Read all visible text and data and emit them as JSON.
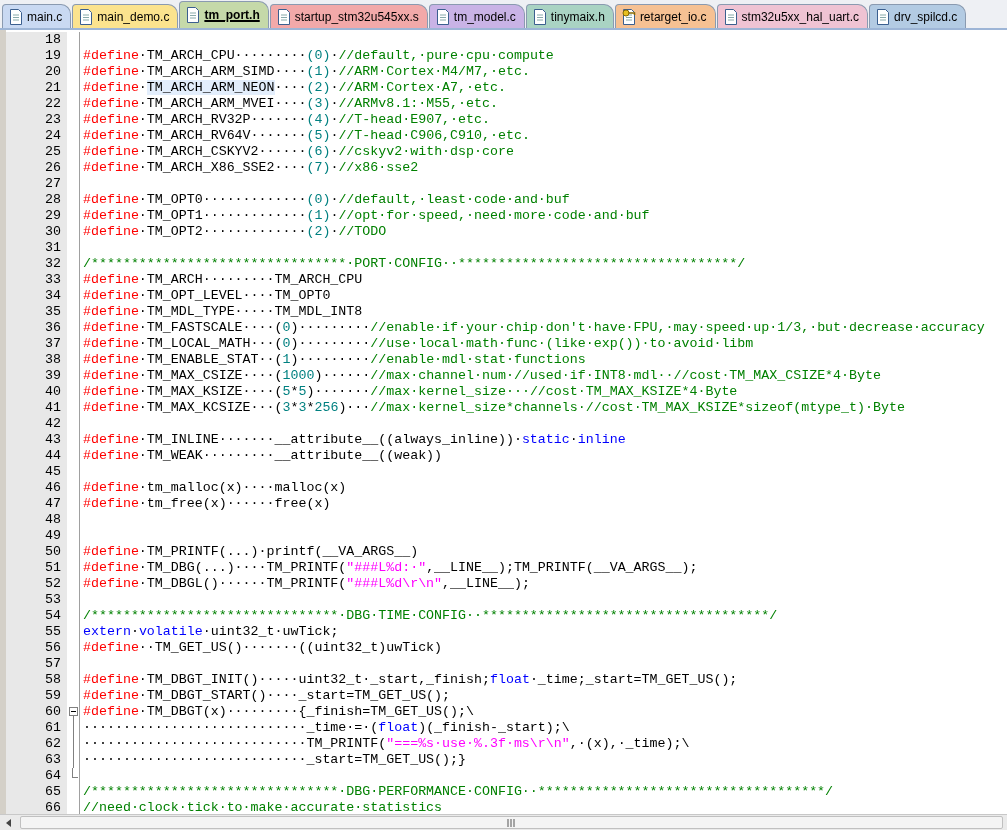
{
  "tabs": [
    {
      "label": "main.c",
      "selected": false,
      "color": "#c9d9f2",
      "kind": "file"
    },
    {
      "label": "main_demo.c",
      "selected": false,
      "color": "#fbe38e",
      "kind": "file"
    },
    {
      "label": "tm_port.h",
      "selected": true,
      "color": "#c5d9a9",
      "kind": "file"
    },
    {
      "label": "startup_stm32u545xx.s",
      "selected": false,
      "color": "#f2a9a9",
      "kind": "file"
    },
    {
      "label": "tm_model.c",
      "selected": false,
      "color": "#c9b3e6",
      "kind": "file"
    },
    {
      "label": "tinymaix.h",
      "selected": false,
      "color": "#a9d3c3",
      "kind": "file"
    },
    {
      "label": "retarget_io.c",
      "selected": false,
      "color": "#f6c193",
      "kind": "keyed"
    },
    {
      "label": "stm32u5xx_hal_uart.c",
      "selected": false,
      "color": "#efc3d3",
      "kind": "file"
    },
    {
      "label": "drv_spilcd.c",
      "selected": false,
      "color": "#b3cbe3",
      "kind": "file"
    }
  ],
  "editor": {
    "lines": [
      {
        "number": "18"
      },
      {
        "number": "19",
        "tokens": [
          {
            "kind": "directive",
            "text": "#define"
          },
          {
            "kind": "plain",
            "text": "·TM_ARCH_CPU·········"
          },
          {
            "kind": "number",
            "text": "(0)"
          },
          {
            "kind": "plain",
            "text": "·"
          },
          {
            "kind": "comment",
            "text": "//default,·pure·cpu·compute"
          }
        ]
      },
      {
        "number": "20",
        "tokens": [
          {
            "kind": "directive",
            "text": "#define"
          },
          {
            "kind": "plain",
            "text": "·TM_ARCH_ARM_SIMD····"
          },
          {
            "kind": "number",
            "text": "(1)"
          },
          {
            "kind": "plain",
            "text": "·"
          },
          {
            "kind": "comment",
            "text": "//ARM·Cortex·M4/M7,·etc."
          }
        ]
      },
      {
        "number": "21",
        "tokens": [
          {
            "kind": "directive",
            "text": "#define"
          },
          {
            "kind": "plain",
            "text": "·"
          },
          {
            "kind": "match",
            "text": "TM_ARCH_ARM_NEON"
          },
          {
            "kind": "plain",
            "text": "····"
          },
          {
            "kind": "number",
            "text": "(2)"
          },
          {
            "kind": "plain",
            "text": "·"
          },
          {
            "kind": "comment",
            "text": "//ARM·Cortex·A7,·etc."
          }
        ]
      },
      {
        "number": "22",
        "tokens": [
          {
            "kind": "directive",
            "text": "#define"
          },
          {
            "kind": "plain",
            "text": "·TM_ARCH_ARM_MVEI····"
          },
          {
            "kind": "number",
            "text": "(3)"
          },
          {
            "kind": "plain",
            "text": "·"
          },
          {
            "kind": "comment",
            "text": "//ARMv8.1:·M55,·etc."
          }
        ]
      },
      {
        "number": "23",
        "tokens": [
          {
            "kind": "directive",
            "text": "#define"
          },
          {
            "kind": "plain",
            "text": "·TM_ARCH_RV32P·······"
          },
          {
            "kind": "number",
            "text": "(4)"
          },
          {
            "kind": "plain",
            "text": "·"
          },
          {
            "kind": "comment",
            "text": "//T-head·E907,·etc."
          }
        ]
      },
      {
        "number": "24",
        "tokens": [
          {
            "kind": "directive",
            "text": "#define"
          },
          {
            "kind": "plain",
            "text": "·TM_ARCH_RV64V·······"
          },
          {
            "kind": "number",
            "text": "(5)"
          },
          {
            "kind": "plain",
            "text": "·"
          },
          {
            "kind": "comment",
            "text": "//T-head·C906,C910,·etc."
          }
        ]
      },
      {
        "number": "25",
        "tokens": [
          {
            "kind": "directive",
            "text": "#define"
          },
          {
            "kind": "plain",
            "text": "·TM_ARCH_CSKYV2······"
          },
          {
            "kind": "number",
            "text": "(6)"
          },
          {
            "kind": "plain",
            "text": "·"
          },
          {
            "kind": "comment",
            "text": "//cskyv2·with·dsp·core"
          }
        ]
      },
      {
        "number": "26",
        "tokens": [
          {
            "kind": "directive",
            "text": "#define"
          },
          {
            "kind": "plain",
            "text": "·TM_ARCH_X86_SSE2····"
          },
          {
            "kind": "number",
            "text": "(7)"
          },
          {
            "kind": "plain",
            "text": "·"
          },
          {
            "kind": "comment",
            "text": "//x86·sse2"
          }
        ]
      },
      {
        "number": "27"
      },
      {
        "number": "28",
        "tokens": [
          {
            "kind": "directive",
            "text": "#define"
          },
          {
            "kind": "plain",
            "text": "·TM_OPT0·············"
          },
          {
            "kind": "number",
            "text": "(0)"
          },
          {
            "kind": "plain",
            "text": "·"
          },
          {
            "kind": "comment",
            "text": "//default,·least·code·and·buf"
          }
        ]
      },
      {
        "number": "29",
        "tokens": [
          {
            "kind": "directive",
            "text": "#define"
          },
          {
            "kind": "plain",
            "text": "·TM_OPT1·············"
          },
          {
            "kind": "number",
            "text": "(1)"
          },
          {
            "kind": "plain",
            "text": "·"
          },
          {
            "kind": "comment",
            "text": "//opt·for·speed,·need·more·code·and·buf"
          }
        ]
      },
      {
        "number": "30",
        "tokens": [
          {
            "kind": "directive",
            "text": "#define"
          },
          {
            "kind": "plain",
            "text": "·TM_OPT2·············"
          },
          {
            "kind": "number",
            "text": "(2)"
          },
          {
            "kind": "plain",
            "text": "·"
          },
          {
            "kind": "comment",
            "text": "//TODO"
          }
        ]
      },
      {
        "number": "31"
      },
      {
        "number": "32",
        "tokens": [
          {
            "kind": "comment",
            "text": "/********************************·PORT·CONFIG··***********************************/"
          }
        ]
      },
      {
        "number": "33",
        "tokens": [
          {
            "kind": "directive",
            "text": "#define"
          },
          {
            "kind": "plain",
            "text": "·TM_ARCH·········TM_ARCH_CPU"
          }
        ]
      },
      {
        "number": "34",
        "tokens": [
          {
            "kind": "directive",
            "text": "#define"
          },
          {
            "kind": "plain",
            "text": "·TM_OPT_LEVEL····TM_OPT0"
          }
        ]
      },
      {
        "number": "35",
        "tokens": [
          {
            "kind": "directive",
            "text": "#define"
          },
          {
            "kind": "plain",
            "text": "·TM_MDL_TYPE·····TM_MDL_INT8"
          }
        ]
      },
      {
        "number": "36",
        "tokens": [
          {
            "kind": "directive",
            "text": "#define"
          },
          {
            "kind": "plain",
            "text": "·TM_FASTSCALE····("
          },
          {
            "kind": "number",
            "text": "0"
          },
          {
            "kind": "plain",
            "text": ")·········"
          },
          {
            "kind": "comment",
            "text": "//enable·if·your·chip·don't·have·FPU,·may·speed·up·1/3,·but·decrease·accuracy"
          }
        ]
      },
      {
        "number": "37",
        "tokens": [
          {
            "kind": "directive",
            "text": "#define"
          },
          {
            "kind": "plain",
            "text": "·TM_LOCAL_MATH···("
          },
          {
            "kind": "number",
            "text": "0"
          },
          {
            "kind": "plain",
            "text": ")·········"
          },
          {
            "kind": "comment",
            "text": "//use·local·math·func·(like·exp())·to·avoid·libm"
          }
        ]
      },
      {
        "number": "38",
        "tokens": [
          {
            "kind": "directive",
            "text": "#define"
          },
          {
            "kind": "plain",
            "text": "·TM_ENABLE_STAT··("
          },
          {
            "kind": "number",
            "text": "1"
          },
          {
            "kind": "plain",
            "text": ")·········"
          },
          {
            "kind": "comment",
            "text": "//enable·mdl·stat·functions"
          }
        ]
      },
      {
        "number": "39",
        "tokens": [
          {
            "kind": "directive",
            "text": "#define"
          },
          {
            "kind": "plain",
            "text": "·TM_MAX_CSIZE····("
          },
          {
            "kind": "number",
            "text": "1000"
          },
          {
            "kind": "plain",
            "text": ")······"
          },
          {
            "kind": "comment",
            "text": "//max·channel·num·//used·if·INT8·mdl··//cost·TM_MAX_CSIZE*4·Byte"
          }
        ]
      },
      {
        "number": "40",
        "tokens": [
          {
            "kind": "directive",
            "text": "#define"
          },
          {
            "kind": "plain",
            "text": "·TM_MAX_KSIZE····("
          },
          {
            "kind": "number",
            "text": "5"
          },
          {
            "kind": "plain",
            "text": "*"
          },
          {
            "kind": "number",
            "text": "5"
          },
          {
            "kind": "plain",
            "text": ")·······"
          },
          {
            "kind": "comment",
            "text": "//max·kernel_size···//cost·TM_MAX_KSIZE*4·Byte"
          }
        ]
      },
      {
        "number": "41",
        "tokens": [
          {
            "kind": "directive",
            "text": "#define"
          },
          {
            "kind": "plain",
            "text": "·TM_MAX_KCSIZE···("
          },
          {
            "kind": "number",
            "text": "3"
          },
          {
            "kind": "plain",
            "text": "*"
          },
          {
            "kind": "number",
            "text": "3"
          },
          {
            "kind": "plain",
            "text": "*"
          },
          {
            "kind": "number",
            "text": "256"
          },
          {
            "kind": "plain",
            "text": ")···"
          },
          {
            "kind": "comment",
            "text": "//max·kernel_size*channels·//cost·TM_MAX_KSIZE*sizeof(mtype_t)·Byte"
          }
        ]
      },
      {
        "number": "42"
      },
      {
        "number": "43",
        "tokens": [
          {
            "kind": "directive",
            "text": "#define"
          },
          {
            "kind": "plain",
            "text": "·TM_INLINE·······__attribute__((always_inline))·"
          },
          {
            "kind": "keyword",
            "text": "static"
          },
          {
            "kind": "plain",
            "text": "·"
          },
          {
            "kind": "keyword",
            "text": "inline"
          }
        ]
      },
      {
        "number": "44",
        "tokens": [
          {
            "kind": "directive",
            "text": "#define"
          },
          {
            "kind": "plain",
            "text": "·TM_WEAK·········__attribute__((weak))"
          }
        ]
      },
      {
        "number": "45"
      },
      {
        "number": "46",
        "tokens": [
          {
            "kind": "directive",
            "text": "#define"
          },
          {
            "kind": "plain",
            "text": "·tm_malloc(x)····malloc(x)"
          }
        ]
      },
      {
        "number": "47",
        "tokens": [
          {
            "kind": "directive",
            "text": "#define"
          },
          {
            "kind": "plain",
            "text": "·tm_free(x)······free(x)"
          }
        ]
      },
      {
        "number": "48"
      },
      {
        "number": "49"
      },
      {
        "number": "50",
        "tokens": [
          {
            "kind": "directive",
            "text": "#define"
          },
          {
            "kind": "plain",
            "text": "·TM_PRINTF(...)·printf(__VA_ARGS__)"
          }
        ]
      },
      {
        "number": "51",
        "tokens": [
          {
            "kind": "directive",
            "text": "#define"
          },
          {
            "kind": "plain",
            "text": "·TM_DBG(...)····TM_PRINTF("
          },
          {
            "kind": "string",
            "text": "\"###L%d:·\""
          },
          {
            "kind": "plain",
            "text": ",__LINE__);TM_PRINTF(__VA_ARGS__);"
          }
        ]
      },
      {
        "number": "52",
        "tokens": [
          {
            "kind": "directive",
            "text": "#define"
          },
          {
            "kind": "plain",
            "text": "·TM_DBGL()······TM_PRINTF("
          },
          {
            "kind": "string",
            "text": "\"###L%d\\r\\n\""
          },
          {
            "kind": "plain",
            "text": ",__LINE__);"
          }
        ]
      },
      {
        "number": "53"
      },
      {
        "number": "54",
        "tokens": [
          {
            "kind": "comment",
            "text": "/*******************************·DBG·TIME·CONFIG··************************************/"
          }
        ]
      },
      {
        "number": "55",
        "tokens": [
          {
            "kind": "keyword",
            "text": "extern"
          },
          {
            "kind": "plain",
            "text": "·"
          },
          {
            "kind": "keyword",
            "text": "volatile"
          },
          {
            "kind": "plain",
            "text": "·uint32_t·uwTick;"
          }
        ]
      },
      {
        "number": "56",
        "tokens": [
          {
            "kind": "directive",
            "text": "#define"
          },
          {
            "kind": "plain",
            "text": "··TM_GET_US()·······((uint32_t)uwTick)"
          }
        ]
      },
      {
        "number": "57"
      },
      {
        "number": "58",
        "tokens": [
          {
            "kind": "directive",
            "text": "#define"
          },
          {
            "kind": "plain",
            "text": "·TM_DBGT_INIT()·····uint32_t·_start,_finish;"
          },
          {
            "kind": "keyword",
            "text": "float"
          },
          {
            "kind": "plain",
            "text": "·_time;_start=TM_GET_US();"
          }
        ]
      },
      {
        "number": "59",
        "tokens": [
          {
            "kind": "directive",
            "text": "#define"
          },
          {
            "kind": "plain",
            "text": "·TM_DBGT_START()····_start=TM_GET_US();"
          }
        ]
      },
      {
        "number": "60",
        "kind": "fold_start",
        "tokens": [
          {
            "kind": "directive",
            "text": "#define"
          },
          {
            "kind": "plain",
            "text": "·TM_DBGT(x)·········{_finish=TM_GET_US();\\"
          }
        ]
      },
      {
        "number": "61",
        "kind": "folded",
        "tokens": [
          {
            "kind": "plain",
            "text": "····························_time·=·("
          },
          {
            "kind": "keyword",
            "text": "float"
          },
          {
            "kind": "plain",
            "text": ")(_finish-_start);\\"
          }
        ]
      },
      {
        "number": "62",
        "kind": "folded",
        "tokens": [
          {
            "kind": "plain",
            "text": "····························TM_PRINTF("
          },
          {
            "kind": "string",
            "text": "\"===%s·use·%.3f·ms\\r\\n\""
          },
          {
            "kind": "plain",
            "text": ",·(x),·_time);\\"
          }
        ]
      },
      {
        "number": "63",
        "kind": "folded",
        "tokens": [
          {
            "kind": "plain",
            "text": "····························_start=TM_GET_US();}"
          }
        ]
      },
      {
        "number": "64",
        "kind": "fold_end"
      },
      {
        "number": "65",
        "tokens": [
          {
            "kind": "comment",
            "text": "/*******************************·DBG·PERFORMANCE·CONFIG··************************************/"
          }
        ]
      },
      {
        "number": "66",
        "tokens": [
          {
            "kind": "comment",
            "text": "//need·clock·tick·to·make·accurate·statistics"
          }
        ]
      }
    ]
  }
}
